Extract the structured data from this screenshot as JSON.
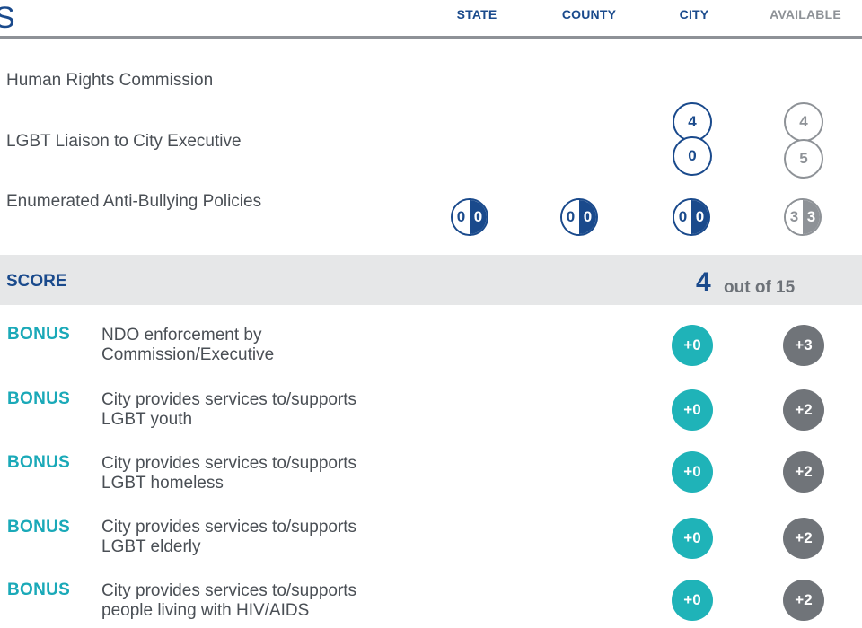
{
  "header": {
    "title_fragment": "S",
    "columns": [
      "STATE",
      "COUNTY",
      "CITY",
      "AVAILABLE"
    ],
    "column_colors": [
      "#1a4a8c",
      "#1a4a8c",
      "#1a4a8c",
      "#8e9297"
    ]
  },
  "rows": [
    {
      "label": "Human Rights Commission",
      "city": "4",
      "available": "4"
    },
    {
      "label": "LGBT Liaison to City Executive",
      "city": "0",
      "available": "5"
    },
    {
      "label": "Enumerated Anti-Bullying Policies",
      "state": [
        "0",
        "0"
      ],
      "county": [
        "0",
        "0"
      ],
      "city": [
        "0",
        "0"
      ],
      "available": [
        "3",
        "3"
      ]
    }
  ],
  "score": {
    "label": "SCORE",
    "value": "4",
    "out_of": "out of 15"
  },
  "bonus": {
    "tag": "BONUS",
    "items": [
      {
        "line1": "NDO enforcement by",
        "line2": "Commission/Executive",
        "city": "+0",
        "available": "+3"
      },
      {
        "line1": "City provides services to/supports",
        "line2": "LGBT youth",
        "city": "+0",
        "available": "+2"
      },
      {
        "line1": "City provides services to/supports",
        "line2": "LGBT homeless",
        "city": "+0",
        "available": "+2"
      },
      {
        "line1": "City provides services to/supports",
        "line2": "LGBT elderly",
        "city": "+0",
        "available": "+2"
      },
      {
        "line1": "City provides services to/supports",
        "line2": "people living with HIV/AIDS",
        "city": "+0",
        "available": "+2"
      }
    ]
  },
  "colors": {
    "brand_blue": "#1a4a8c",
    "grey": "#8e9297",
    "teal": "#1fb3b8",
    "bonus_teal_text": "#1aa9b8",
    "dark_grey": "#707479",
    "band": "#e6e7e8"
  }
}
